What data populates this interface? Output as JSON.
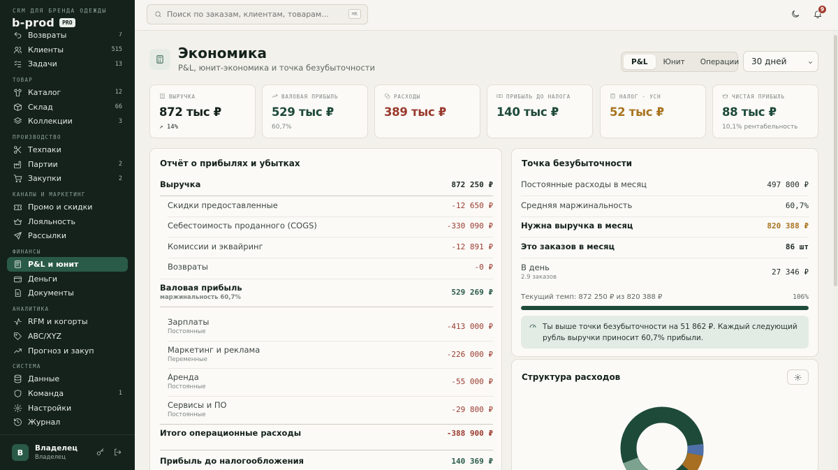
{
  "sidebar": {
    "tagline": "CRM ДЛЯ БРЕНДА ОДЕЖДЫ",
    "brand": "b-prod",
    "badge": "PRO",
    "groups": [
      {
        "section": "",
        "items": [
          {
            "label": "Возвраты",
            "count": "7",
            "icon": "return-icon"
          },
          {
            "label": "Клиенты",
            "count": "515",
            "icon": "users-icon"
          },
          {
            "label": "Задачи",
            "count": "13",
            "icon": "tasks-icon"
          }
        ]
      },
      {
        "section": "ТОВАР",
        "items": [
          {
            "label": "Каталог",
            "count": "12",
            "icon": "shirt-icon"
          },
          {
            "label": "Склад",
            "count": "66",
            "icon": "box-icon"
          },
          {
            "label": "Коллекции",
            "count": "3",
            "icon": "layers-icon"
          }
        ]
      },
      {
        "section": "ПРОИЗВОДСТВО",
        "items": [
          {
            "label": "Техпаки",
            "count": "",
            "icon": "scissors-icon"
          },
          {
            "label": "Партии",
            "count": "2",
            "icon": "factory-icon"
          },
          {
            "label": "Закупки",
            "count": "2",
            "icon": "cart-icon"
          }
        ]
      },
      {
        "section": "КАНАЛЫ И МАРКЕТИНГ",
        "items": [
          {
            "label": "Промо и скидки",
            "count": "",
            "icon": "ticket-icon"
          },
          {
            "label": "Лояльность",
            "count": "",
            "icon": "crown-icon"
          },
          {
            "label": "Рассылки",
            "count": "",
            "icon": "send-icon"
          }
        ]
      },
      {
        "section": "ФИНАНСЫ",
        "items": [
          {
            "label": "P&L и юнит",
            "count": "",
            "icon": "calculator-icon",
            "active": true
          },
          {
            "label": "Деньги",
            "count": "",
            "icon": "wallet-icon"
          },
          {
            "label": "Документы",
            "count": "",
            "icon": "document-icon"
          }
        ]
      },
      {
        "section": "АНАЛИТИКА",
        "items": [
          {
            "label": "RFM и когорты",
            "count": "",
            "icon": "activity-icon"
          },
          {
            "label": "ABC/XYZ",
            "count": "",
            "icon": "tag-icon"
          },
          {
            "label": "Прогноз и закуп",
            "count": "",
            "icon": "trend-icon"
          }
        ]
      },
      {
        "section": "СИСТЕМА",
        "items": [
          {
            "label": "Данные",
            "count": "",
            "icon": "database-icon"
          },
          {
            "label": "Команда",
            "count": "1",
            "icon": "shield-icon"
          },
          {
            "label": "Настройки",
            "count": "",
            "icon": "gear-icon"
          },
          {
            "label": "Журнал",
            "count": "",
            "icon": "history-icon"
          }
        ]
      }
    ],
    "user": {
      "initial": "В",
      "name": "Владелец",
      "role": "Владелец"
    }
  },
  "topbar": {
    "search_placeholder": "Поиск по заказам, клиентам, товарам...",
    "shortcut": "⌘K",
    "notifications": "9"
  },
  "header": {
    "title": "Экономика",
    "subtitle": "P&L, юнит-экономика и точка безубыточности",
    "tabs": [
      "P&L",
      "Юнит",
      "Операции"
    ],
    "active_tab": "P&L",
    "period": "30 дней"
  },
  "kpis": [
    {
      "label": "ВЫРУЧКА",
      "value": "872 тыс ₽",
      "sub": "↗ 14%",
      "icon": "receipt-icon",
      "tone": "default"
    },
    {
      "label": "ВАЛОВАЯ ПРИБЫЛЬ",
      "value": "529 тыс ₽",
      "sub": "60,7%",
      "icon": "trend-icon",
      "tone": "pos"
    },
    {
      "label": "РАСХОДЫ",
      "value": "389 тыс ₽",
      "sub": "",
      "icon": "coins-icon",
      "tone": "neg"
    },
    {
      "label": "ПРИБЫЛЬ ДО НАЛОГА",
      "value": "140 тыс ₽",
      "sub": "",
      "icon": "banknote-icon",
      "tone": "pos"
    },
    {
      "label": "НАЛОГ · УСН",
      "value": "52 тыс ₽",
      "sub": "",
      "icon": "calculator-icon",
      "tone": "gold"
    },
    {
      "label": "ЧИСТАЯ ПРИБЫЛЬ",
      "value": "88 тыс ₽",
      "sub": "10,1% рентабельность",
      "icon": "crown-icon",
      "tone": "pos"
    }
  ],
  "pl": {
    "title": "Отчёт о прибылях и убытках",
    "rows": [
      {
        "name": "Выручка",
        "note": "",
        "value": "872 250 ₽",
        "kind": "bold",
        "tone": ""
      },
      {
        "name": "Скидки предоставленные",
        "note": "",
        "value": "-12 650 ₽",
        "kind": "sub",
        "tone": "neg"
      },
      {
        "name": "Себестоимость проданного (COGS)",
        "note": "",
        "value": "-330 090 ₽",
        "kind": "sub",
        "tone": "neg"
      },
      {
        "name": "Комиссии и эквайринг",
        "note": "",
        "value": "-12 891 ₽",
        "kind": "sub",
        "tone": "neg"
      },
      {
        "name": "Возвраты",
        "note": "",
        "value": "-0 ₽",
        "kind": "sub",
        "tone": "neg"
      },
      {
        "name": "Валовая прибыль",
        "note": "маржинальность 60,7%",
        "value": "529 269 ₽",
        "kind": "bold",
        "tone": "pos"
      },
      {
        "name": "Зарплаты",
        "note": "Постоянные",
        "value": "-413 000 ₽",
        "kind": "sub",
        "tone": "neg"
      },
      {
        "name": "Маркетинг и реклама",
        "note": "Переменные",
        "value": "-226 000 ₽",
        "kind": "sub",
        "tone": "neg"
      },
      {
        "name": "Аренда",
        "note": "Постоянные",
        "value": "-55 000 ₽",
        "kind": "sub",
        "tone": "neg"
      },
      {
        "name": "Сервисы и ПО",
        "note": "Постоянные",
        "value": "-29 800 ₽",
        "kind": "sub",
        "tone": "neg"
      },
      {
        "name": "Итого операционные расходы",
        "note": "",
        "value": "-388 900 ₽",
        "kind": "bold",
        "tone": "neg"
      },
      {
        "name": "Прибыль до налогообложения",
        "note": "",
        "value": "140 369 ₽",
        "kind": "bold",
        "tone": "pos"
      }
    ]
  },
  "breakeven": {
    "title": "Точка безубыточности",
    "rows": [
      {
        "name": "Постоянные расходы в месяц",
        "note": "",
        "value": "497 800 ₽",
        "kind": "",
        "tone": ""
      },
      {
        "name": "Средняя маржинальность",
        "note": "",
        "value": "60,7%",
        "kind": "",
        "tone": ""
      },
      {
        "name": "Нужна выручка в месяц",
        "note": "",
        "value": "820 388 ₽",
        "kind": "bold",
        "tone": "gold"
      },
      {
        "name": "Это заказов в месяц",
        "note": "",
        "value": "86 шт",
        "kind": "bold",
        "tone": ""
      },
      {
        "name": "В день",
        "note": "2.9 заказов",
        "value": "27 346 ₽",
        "kind": "",
        "tone": ""
      }
    ],
    "pace_label": "Текущий темп: 872 250 ₽ из 820 388 ₽",
    "pace_percent_label": "106%",
    "pace_fraction": 1.0,
    "note": "Ты выше точки безубыточности на 51 862 ₽. Каждый следующий рубль выручки приносит 60,7% прибыли."
  },
  "expenses": {
    "title": "Структура расходов"
  },
  "colors": {
    "accent": "#2a5a48",
    "negative": "#9a3a2e",
    "gold": "#a87420",
    "sidebar": "#15221c"
  }
}
